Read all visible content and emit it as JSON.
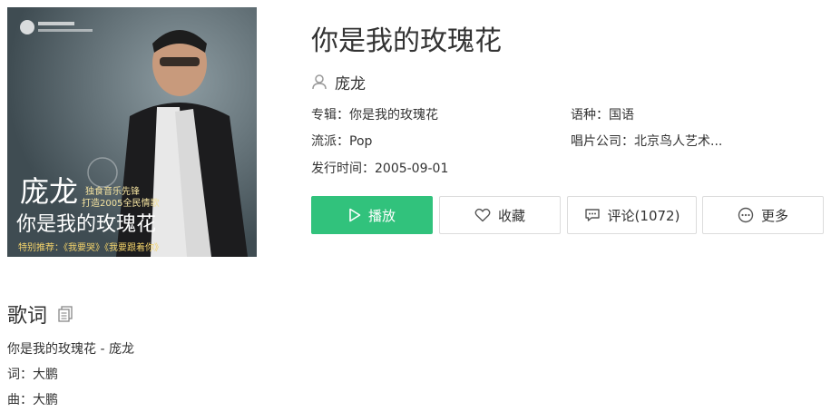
{
  "album_cover": {
    "artist_text": "庞龙",
    "title_text": "你是我的玫瑰花",
    "promo_line_1": "独食音乐先锋",
    "promo_line_2": "打造2005全民情歌",
    "bottom_text": "特别推荐：《我要哭》《我要跟着你》"
  },
  "song": {
    "title": "你是我的玫瑰花",
    "artist": "庞龙",
    "album": "专辑：你是我的玫瑰花",
    "language": "语种：国语",
    "genre": "流派：Pop",
    "label": "唱片公司：北京鸟人艺术...",
    "release": "发行时间：2005-09-01"
  },
  "actions": {
    "play": "播放",
    "favorite": "收藏",
    "comments": "评论(1072)",
    "more": "更多"
  },
  "lyrics": {
    "heading": "歌词",
    "lines": [
      "你是我的玫瑰花 - 庞龙",
      "词：大鹏",
      "曲：大鹏"
    ]
  },
  "colors": {
    "play_button": "#31c27c",
    "text": "#333333",
    "border": "#dcdcdc"
  }
}
